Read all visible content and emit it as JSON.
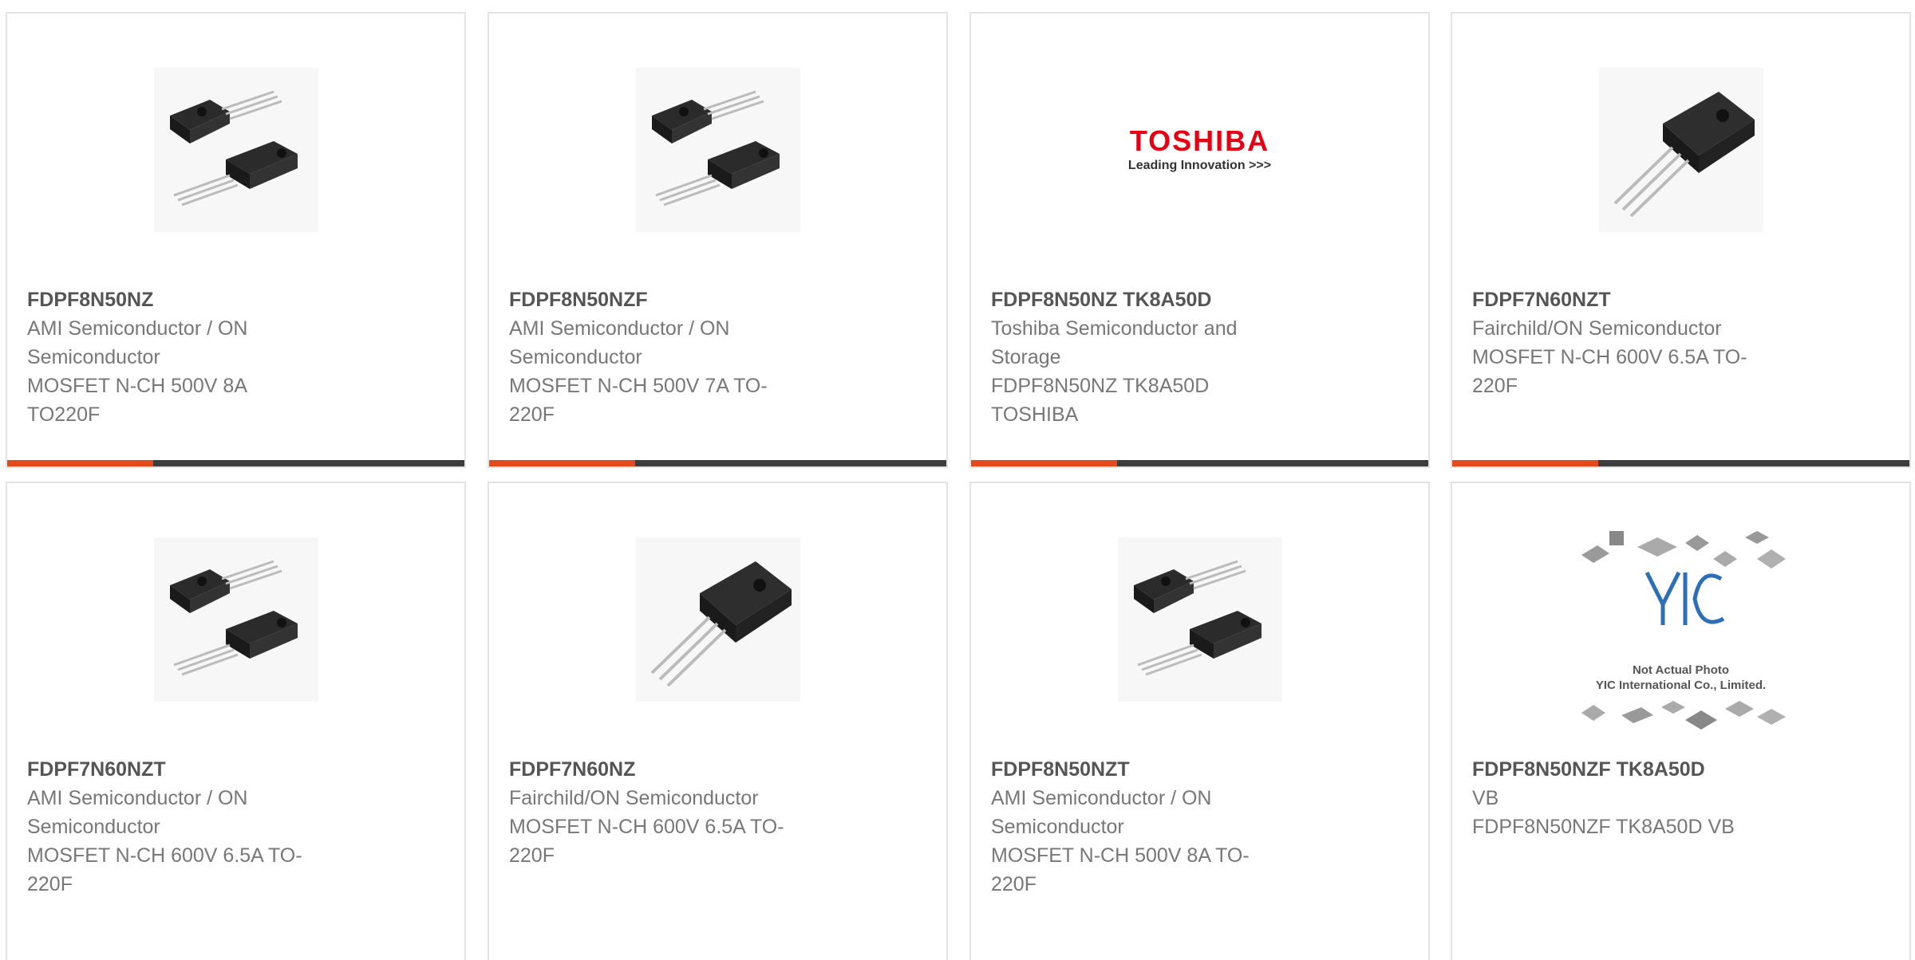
{
  "theme": {
    "accent": "#e34a1c",
    "bar": "#3d3d3d"
  },
  "products": [
    {
      "part": "FDPF8N50NZ",
      "mfr_lines": [
        "AMI Semiconductor / ON",
        "Semiconductor"
      ],
      "desc_lines": [
        "MOSFET N-CH 500V 8A",
        "TO220F"
      ],
      "image": "two-to220-transistors"
    },
    {
      "part": "FDPF8N50NZF",
      "mfr_lines": [
        "AMI Semiconductor / ON",
        "Semiconductor"
      ],
      "desc_lines": [
        "MOSFET N-CH 500V 7A TO-",
        "220F"
      ],
      "image": "two-to220-transistors"
    },
    {
      "part": "FDPF8N50NZ TK8A50D",
      "mfr_lines": [
        "Toshiba Semiconductor and",
        "Storage"
      ],
      "desc_lines": [
        "FDPF8N50NZ TK8A50D",
        "TOSHIBA"
      ],
      "image": "toshiba-logo",
      "logo": {
        "word": "TOSHIBA",
        "tagline": "Leading Innovation >>>",
        "color": "#e60012"
      }
    },
    {
      "part": "FDPF7N60NZT",
      "mfr_lines": [
        "Fairchild/ON Semiconductor"
      ],
      "desc_lines": [
        "MOSFET N-CH 600V 6.5A TO-",
        "220F"
      ],
      "image": "single-to220-transistor"
    },
    {
      "part": "FDPF7N60NZT",
      "mfr_lines": [
        "AMI Semiconductor / ON",
        "Semiconductor"
      ],
      "desc_lines": [
        "MOSFET N-CH 600V 6.5A TO-",
        "220F"
      ],
      "image": "two-to220-transistors"
    },
    {
      "part": "FDPF7N60NZ",
      "mfr_lines": [
        "Fairchild/ON Semiconductor"
      ],
      "desc_lines": [
        "MOSFET N-CH 600V 6.5A TO-",
        "220F"
      ],
      "image": "single-to220-transistor"
    },
    {
      "part": "FDPF8N50NZT",
      "mfr_lines": [
        "AMI Semiconductor / ON",
        "Semiconductor"
      ],
      "desc_lines": [
        "MOSFET N-CH 500V 8A TO-",
        "220F"
      ],
      "image": "two-to220-transistors"
    },
    {
      "part": "FDPF8N50NZF TK8A50D",
      "mfr_lines": [
        "VB"
      ],
      "desc_lines": [
        "FDPF8N50NZF TK8A50D VB"
      ],
      "image": "yic-placeholder",
      "placeholder": {
        "line1": "Not Actual Photo",
        "line2": "YIC International Co., Limited."
      }
    }
  ]
}
